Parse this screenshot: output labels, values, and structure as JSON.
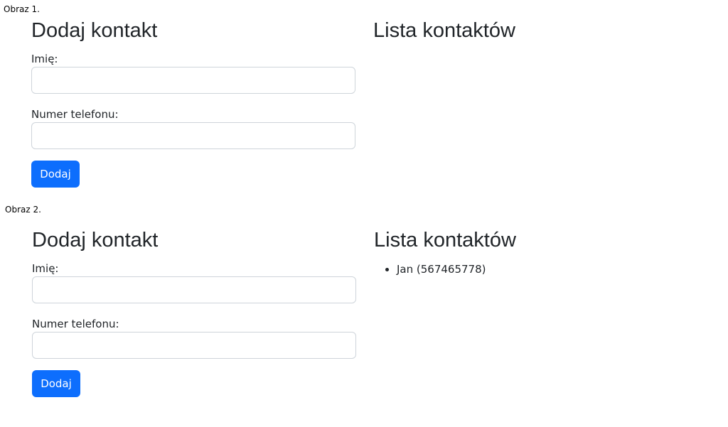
{
  "captions": [
    "Obraz 1.",
    "Obraz 2."
  ],
  "form": {
    "title": "Dodaj kontakt",
    "name_label": "Imię:",
    "phone_label": "Numer telefonu:",
    "name_value": "",
    "phone_value": "",
    "submit_label": "Dodaj"
  },
  "list": {
    "title": "Lista kontaktów"
  },
  "panels": [
    {
      "contacts": []
    },
    {
      "contacts": [
        "Jan (567465778)"
      ]
    }
  ],
  "colors": {
    "primary_button": "#0d6efd",
    "input_border": "#ced4da",
    "text": "#212529"
  }
}
